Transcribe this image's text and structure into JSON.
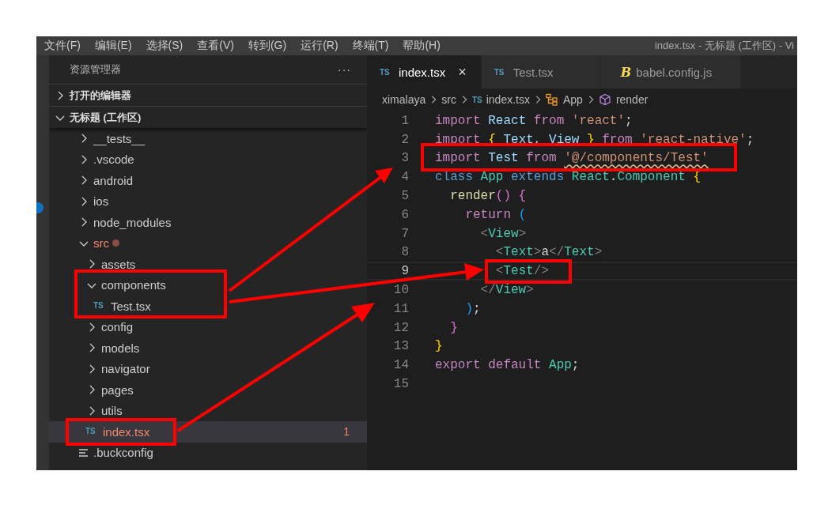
{
  "menu": [
    "文件(F)",
    "编辑(E)",
    "选择(S)",
    "查看(V)",
    "转到(G)",
    "运行(R)",
    "终端(T)",
    "帮助(H)"
  ],
  "window": {
    "title": "index.tsx - 无标题 (工作区) - Vi"
  },
  "sidebar": {
    "title": "资源管理器",
    "more": "···",
    "sections": [
      {
        "label": "打开的编辑器",
        "expanded": false
      },
      {
        "label": "无标题 (工作区)",
        "expanded": true
      }
    ],
    "tree": [
      {
        "name": "__tests__",
        "kind": "folder",
        "expanded": false,
        "selected": false,
        "error": false
      },
      {
        "name": ".vscode",
        "kind": "folder",
        "expanded": false,
        "selected": false,
        "error": false
      },
      {
        "name": "android",
        "kind": "folder",
        "expanded": false,
        "selected": false,
        "error": false
      },
      {
        "name": "ios",
        "kind": "folder",
        "expanded": false,
        "selected": false,
        "error": false
      },
      {
        "name": "node_modules",
        "kind": "folder",
        "expanded": false,
        "selected": false,
        "error": false
      },
      {
        "name": "src",
        "kind": "folder",
        "expanded": true,
        "selected": false,
        "error": true,
        "children": [
          {
            "name": "assets",
            "kind": "folder",
            "expanded": false,
            "selected": false,
            "error": false
          },
          {
            "name": "components",
            "kind": "folder",
            "expanded": true,
            "selected": false,
            "error": false,
            "children": [
              {
                "name": "Test.tsx",
                "kind": "file",
                "icon": "TS",
                "selected": false,
                "error": false
              }
            ]
          },
          {
            "name": "config",
            "kind": "folder",
            "expanded": false,
            "selected": false,
            "error": false
          },
          {
            "name": "models",
            "kind": "folder",
            "expanded": false,
            "selected": false,
            "error": false
          },
          {
            "name": "navigator",
            "kind": "folder",
            "expanded": false,
            "selected": false,
            "error": false
          },
          {
            "name": "pages",
            "kind": "folder",
            "expanded": false,
            "selected": false,
            "error": false
          },
          {
            "name": "utils",
            "kind": "folder",
            "expanded": false,
            "selected": false,
            "error": false
          },
          {
            "name": "index.tsx",
            "kind": "file",
            "icon": "TS",
            "selected": true,
            "error": true,
            "badge": "1"
          }
        ]
      },
      {
        "name": ".buckconfig",
        "kind": "config",
        "selected": false,
        "error": false
      }
    ]
  },
  "tabs": [
    {
      "label": "index.tsx",
      "icon": "TS",
      "selected": true,
      "close": "×"
    },
    {
      "label": "Test.tsx",
      "icon": "TS",
      "selected": false
    },
    {
      "label": "babel.config.js",
      "icon": "B",
      "selected": false
    }
  ],
  "breadcrumbs": [
    {
      "label": "ximalaya",
      "kind": "folder"
    },
    {
      "label": "src",
      "kind": "folder"
    },
    {
      "label": "index.tsx",
      "kind": "ts",
      "icon": "TS"
    },
    {
      "label": "App",
      "kind": "class"
    },
    {
      "label": "render",
      "kind": "method"
    }
  ],
  "code": [
    {
      "n": "1",
      "current": false,
      "tokens": [
        {
          "text": "import ",
          "kind": "keyword"
        },
        {
          "text": "React ",
          "kind": "variable"
        },
        {
          "text": "from ",
          "kind": "keyword"
        },
        {
          "text": "'react'",
          "kind": "string"
        },
        {
          "text": ";",
          "kind": "plain"
        }
      ]
    },
    {
      "n": "2",
      "current": false,
      "tokens": [
        {
          "text": "import ",
          "kind": "keyword"
        },
        {
          "text": "{ ",
          "kind": "brace1"
        },
        {
          "text": "Text, ",
          "kind": "variable"
        },
        {
          "text": "View ",
          "kind": "variable"
        },
        {
          "text": "} ",
          "kind": "brace1"
        },
        {
          "text": "from ",
          "kind": "keyword"
        },
        {
          "text": "'react-native'",
          "kind": "string"
        },
        {
          "text": ";",
          "kind": "plain"
        }
      ]
    },
    {
      "n": "3",
      "current": false,
      "tokens": [
        {
          "text": "import ",
          "kind": "keyword"
        },
        {
          "text": "Test ",
          "kind": "variable"
        },
        {
          "text": "from ",
          "kind": "keyword"
        },
        {
          "text": "'@/components/Test'",
          "kind": "error"
        }
      ]
    },
    {
      "n": "4",
      "current": false,
      "tokens": [
        {
          "text": "class ",
          "kind": "storage"
        },
        {
          "text": "App ",
          "kind": "type"
        },
        {
          "text": "extends ",
          "kind": "storage"
        },
        {
          "text": "React",
          "kind": "type"
        },
        {
          "text": ".",
          "kind": "plain"
        },
        {
          "text": "Component ",
          "kind": "type"
        },
        {
          "text": "{",
          "kind": "brace1"
        }
      ]
    },
    {
      "n": "5",
      "current": false,
      "tokens": [
        {
          "text": "  render",
          "kind": "function"
        },
        {
          "text": "() {",
          "kind": "brace2"
        }
      ]
    },
    {
      "n": "6",
      "current": false,
      "tokens": [
        {
          "text": "    return ",
          "kind": "keyword"
        },
        {
          "text": "(",
          "kind": "brace3"
        }
      ]
    },
    {
      "n": "7",
      "current": false,
      "tokens": [
        {
          "text": "      <",
          "kind": "punct"
        },
        {
          "text": "View",
          "kind": "type"
        },
        {
          "text": ">",
          "kind": "punct"
        }
      ]
    },
    {
      "n": "8",
      "current": false,
      "tokens": [
        {
          "text": "        <",
          "kind": "punct"
        },
        {
          "text": "Text",
          "kind": "type"
        },
        {
          "text": ">",
          "kind": "punct"
        },
        {
          "text": "a",
          "kind": "plain"
        },
        {
          "text": "</",
          "kind": "punct"
        },
        {
          "text": "Text",
          "kind": "type"
        },
        {
          "text": ">",
          "kind": "punct"
        }
      ]
    },
    {
      "n": "9",
      "current": true,
      "tokens": [
        {
          "text": "        <",
          "kind": "punct"
        },
        {
          "text": "Test",
          "kind": "type"
        },
        {
          "text": "/>",
          "kind": "punct"
        }
      ]
    },
    {
      "n": "10",
      "current": false,
      "tokens": [
        {
          "text": "      </",
          "kind": "punct"
        },
        {
          "text": "View",
          "kind": "type"
        },
        {
          "text": ">",
          "kind": "punct"
        }
      ]
    },
    {
      "n": "11",
      "current": false,
      "tokens": [
        {
          "text": "    )",
          "kind": "brace3"
        },
        {
          "text": ";",
          "kind": "plain"
        }
      ]
    },
    {
      "n": "12",
      "current": false,
      "tokens": [
        {
          "text": "  }",
          "kind": "brace2"
        }
      ]
    },
    {
      "n": "13",
      "current": false,
      "tokens": [
        {
          "text": "}",
          "kind": "brace1"
        }
      ]
    },
    {
      "n": "14",
      "current": false,
      "tokens": [
        {
          "text": "export default ",
          "kind": "keyword"
        },
        {
          "text": "App",
          "kind": "type"
        },
        {
          "text": ";",
          "kind": "plain"
        }
      ]
    },
    {
      "n": "15",
      "current": false
    }
  ]
}
